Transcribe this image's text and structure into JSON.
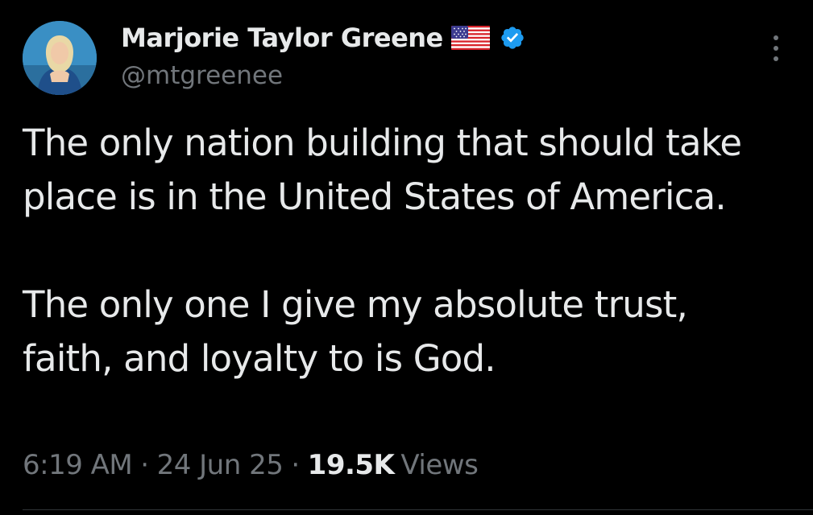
{
  "author": {
    "display_name": "Marjorie Taylor Greene",
    "handle": "@mtgreenee",
    "flag_icon": "us-flag-icon",
    "verified_icon": "verified-badge-icon",
    "verified_color": "#1d9bf0"
  },
  "tweet": {
    "paragraphs": [
      "The only nation building that should take place is in the United States of America.",
      "The only one I give my absolute trust, faith, and loyalty to is God."
    ]
  },
  "meta": {
    "time": "6:19 AM",
    "separator": "·",
    "date": "24 Jun 25",
    "views_count": "19.5K",
    "views_label": "Views"
  },
  "colors": {
    "background": "#000000",
    "text_primary": "#e7e9ea",
    "text_secondary": "#71767b",
    "divider": "#2f3336"
  }
}
